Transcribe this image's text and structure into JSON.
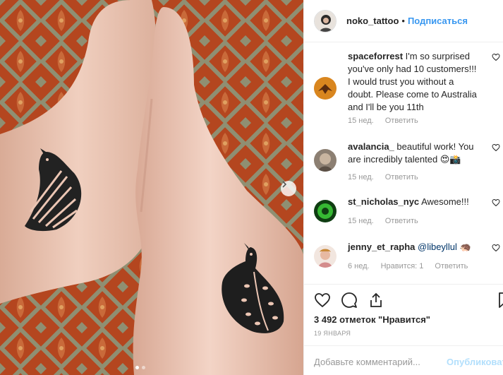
{
  "header": {
    "username": "noko_tattoo",
    "separator": "•",
    "follow_label": "Подписаться"
  },
  "comments": [
    {
      "username": "spaceforrest",
      "text": "I'm so surprised you've only had 10 customers!!! I would trust you without a doubt. Please come to Australia and I'll be you 11th",
      "time": "15 нед.",
      "reply_label": "Ответить"
    },
    {
      "username": "avalancia_",
      "text": "beautiful work! You are incredibly talented 😍📸",
      "time": "15 нед.",
      "reply_label": "Ответить"
    },
    {
      "username": "st_nicholas_nyc",
      "text": "Awesome!!!",
      "time": "15 нед.",
      "reply_label": "Ответить"
    },
    {
      "username": "jenny_et_rapha",
      "mention": "@libeyllul",
      "text": "🦔",
      "time": "6 нед.",
      "likes_label": "Нравится: 1",
      "reply_label": "Ответить"
    }
  ],
  "post": {
    "likes": "3 492 отметок \"Нравится\"",
    "date": "19 ЯНВАРЯ"
  },
  "comment_box": {
    "placeholder": "Добавьте комментарий...",
    "publish_label": "Опубликовать"
  },
  "carousel": {
    "total": 2,
    "active": 1
  },
  "colors": {
    "link_blue": "#3897f0",
    "publish_disabled": "#b2dffc",
    "mention": "#003569",
    "meta_gray": "#999999",
    "fabric_red": "#b4461f",
    "fabric_pattern": "#8f8f72",
    "skin": "#ecc6b4"
  },
  "icons": {
    "like": "heart-icon",
    "comment": "comment-icon",
    "share": "share-icon",
    "save": "bookmark-icon",
    "next": "chevron-right-icon"
  }
}
